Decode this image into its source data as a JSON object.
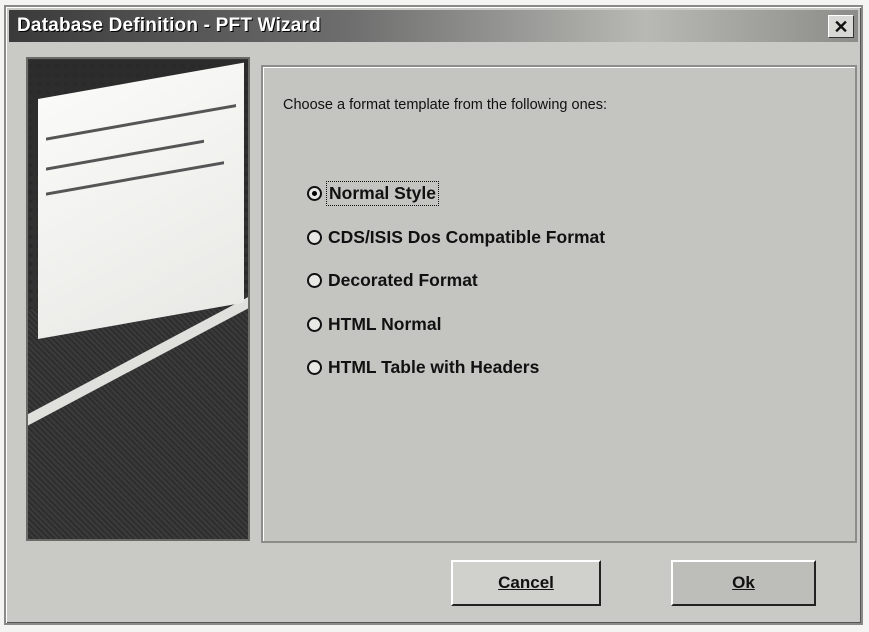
{
  "window": {
    "title": "Database Definition - PFT Wizard",
    "close_glyph": "✕"
  },
  "content": {
    "prompt": "Choose a format template from the following ones:",
    "options": [
      {
        "label": "Normal Style",
        "selected": true
      },
      {
        "label": "CDS/ISIS Dos Compatible Format",
        "selected": false
      },
      {
        "label": "Decorated Format",
        "selected": false
      },
      {
        "label": "HTML Normal",
        "selected": false
      },
      {
        "label": "HTML Table with Headers",
        "selected": false
      }
    ]
  },
  "buttons": {
    "cancel": "Cancel",
    "ok": "Ok"
  },
  "icons": {
    "close": "close-icon",
    "radio_selected": "radio-selected-icon",
    "radio_unselected": "radio-unselected-icon"
  }
}
